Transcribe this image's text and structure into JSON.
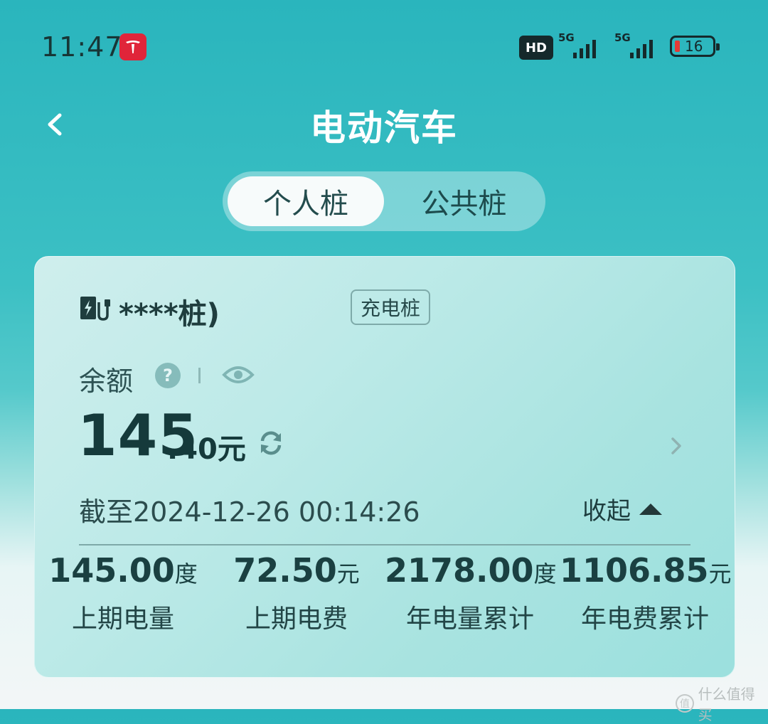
{
  "status_bar": {
    "time": "11:47",
    "hd_label": "HD",
    "network_1": "5G",
    "network_2": "5G",
    "battery_level": "16",
    "battery_color": "#e53935"
  },
  "header": {
    "title": "电动汽车",
    "back_icon": "chevron-left-icon"
  },
  "tabs": [
    {
      "label": "个人桩",
      "active": true
    },
    {
      "label": "公共桩",
      "active": false
    }
  ],
  "card": {
    "pile_icon": "charging-station-icon",
    "pile_name": "****桩)",
    "pile_tag": "充电桩",
    "balance_label": "余额",
    "help_glyph": "?",
    "balance_integer": "145",
    "balance_decimal": ".40元",
    "as_of": "截至2024-12-26 00:14:26",
    "collapse_label": "收起",
    "stats": [
      {
        "value": "145.00",
        "unit": "度",
        "label": "上期电量"
      },
      {
        "value": "72.50",
        "unit": "元",
        "label": "上期电费"
      },
      {
        "value": "2178.00",
        "unit": "度",
        "label": "年电量累计"
      },
      {
        "value": "1106.85",
        "unit": "元",
        "label": "年电费累计"
      }
    ]
  },
  "watermark": {
    "text": "什么值得买",
    "glyph": "值"
  },
  "colors": {
    "accent": "#2ab5bd",
    "text_dark": "#153a3b",
    "tesla_red": "#e0253a"
  }
}
